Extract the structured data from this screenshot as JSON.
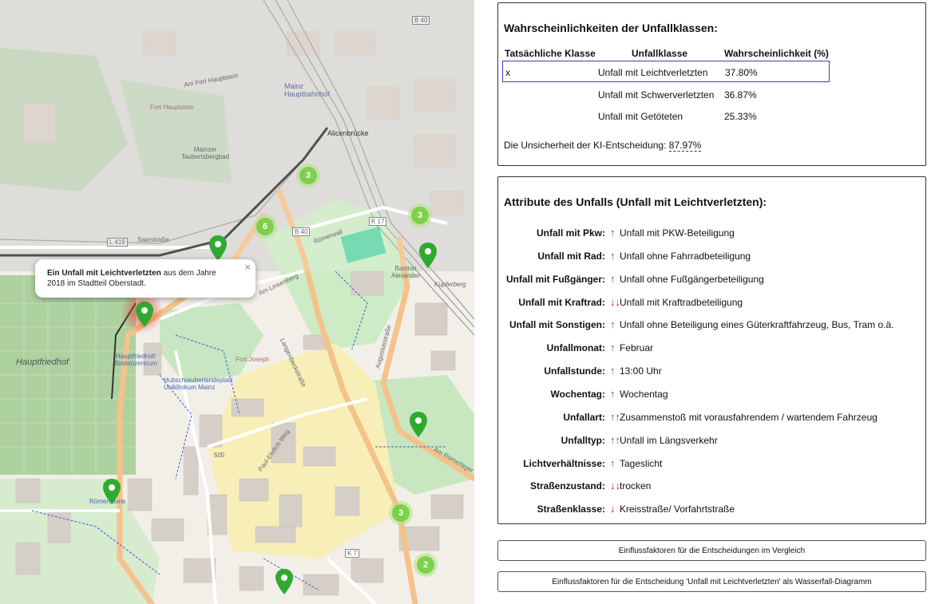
{
  "map": {
    "popup": {
      "title": "Ein Unfall mit Leichtverletzten",
      "text_line1": " aus dem Jahre",
      "text_line2": "2018 im Stadtteil Oberstadt.",
      "close": "×"
    },
    "clusters": [
      {
        "count": "3"
      },
      {
        "count": "6"
      },
      {
        "count": "3"
      },
      {
        "count": "3"
      },
      {
        "count": "2"
      }
    ],
    "labels": {
      "hauptfriedhof": "Hauptfriedhof",
      "mainz_hbf": "Mainz Hauptbahnhof",
      "alicenbruecke": "Alicenbrücke",
      "saarstrasse": "Saarstraße",
      "roemerwall": "Römerwall",
      "am_linsenberg": "Am Linsenberg",
      "langenbeckstrasse": "Langenbeckstraße",
      "augustusstrasse": "Augustusstraße",
      "am_roemerlager": "Am Römerlager",
      "fort_hauptstein": "Fort Hauptstein",
      "taubertsbergbad": "Mainzer Taubertsbergbad",
      "bastion": "Bastion Alexander",
      "hauptfriedhof_stop": "Hauptfriedhof/ Bindenzentrum",
      "roemersteine": "Römersteine",
      "k17": "K 17",
      "b40": "B 40",
      "b40b": "B 40",
      "l419": "L 419",
      "k7": "K 7",
      "n505": "505",
      "paul_ehrlich": "Paul-Ehrlich-Weg",
      "kupferberg": "Kupferberg",
      "am_fort_hauptstein": "Am Fort Hauptstein",
      "unikl": "Hubschrauberlandeplatz Uniklinikum Mainz",
      "fort_joseph": "Fort Joseph"
    }
  },
  "probabilities": {
    "title": "Wahrscheinlichkeiten der Unfallklassen:",
    "headers": [
      "Tatsächliche Klasse",
      "Unfallklasse",
      "Wahrscheinlichkeit (%)"
    ],
    "rows": [
      {
        "actual": "x",
        "class": "Unfall mit Leichtverletzten",
        "prob": "37.80%"
      },
      {
        "actual": "",
        "class": "Unfall mit Schwerverletzten",
        "prob": "36.87%"
      },
      {
        "actual": "",
        "class": "Unfall mit Getöteten",
        "prob": "25.33%"
      }
    ],
    "uncertainty_label": "Die Unsicherheit der KI-Entscheidung: ",
    "uncertainty_value": "87.97%"
  },
  "attributes": {
    "title": "Attribute des Unfalls (Unfall mit Leichtverletzten):",
    "rows": [
      {
        "label": "Unfall mit Pkw:",
        "arrow": "↑",
        "dir": "up",
        "value": "Unfall mit PKW-Beteiligung"
      },
      {
        "label": "Unfall mit Rad:",
        "arrow": "↑",
        "dir": "up",
        "value": "Unfall ohne Fahrradbeteiligung"
      },
      {
        "label": "Unfall mit Fußgänger:",
        "arrow": "↑",
        "dir": "up",
        "value": "Unfall ohne Fußgängerbeteiligung"
      },
      {
        "label": "Unfall mit Kraftrad:",
        "arrow": "↓↓",
        "dir": "down",
        "value": "Unfall mit Kraftradbeteiligung"
      },
      {
        "label": "Unfall mit Sonstigen:",
        "arrow": "↑",
        "dir": "up",
        "value": "Unfall ohne Beteiligung eines Güterkraftfahrzeug, Bus, Tram o.ä."
      },
      {
        "label": "Unfallmonat:",
        "arrow": "↑",
        "dir": "up",
        "value": "Februar"
      },
      {
        "label": "Unfallstunde:",
        "arrow": "↑",
        "dir": "up",
        "value": "13:00 Uhr"
      },
      {
        "label": "Wochentag:",
        "arrow": "↑",
        "dir": "up",
        "value": "Wochentag"
      },
      {
        "label": "Unfallart:",
        "arrow": "↑↑",
        "dir": "up",
        "value": "Zusammenstoß mit vorausfahrendem / wartendem Fahrzeug"
      },
      {
        "label": "Unfalltyp:",
        "arrow": "↑↑",
        "dir": "up",
        "value": "Unfall im Längsverkehr"
      },
      {
        "label": "Lichtverhältnisse:",
        "arrow": "↑",
        "dir": "up",
        "value": "Tageslicht"
      },
      {
        "label": "Straßenzustand:",
        "arrow": "↓↓",
        "dir": "down",
        "value": "trocken"
      },
      {
        "label": "Straßenklasse:",
        "arrow": "↓",
        "dir": "down",
        "value": "Kreisstraße/ Vorfahrtstraße"
      }
    ]
  },
  "buttons": {
    "compare": "Einflussfaktoren für die Entscheidungen im Vergleich",
    "waterfall": "Einflussfaktoren für die Entscheidung 'Unfall mit Leichtverletzten' als Wasserfall-Diagramm"
  },
  "colors": {
    "marker_green": "#2faa2f",
    "marker_red": "#e53b2f",
    "arrow_up": "#1a8a1a",
    "arrow_down": "#d01818",
    "selected_border": "#3b3bbf"
  }
}
